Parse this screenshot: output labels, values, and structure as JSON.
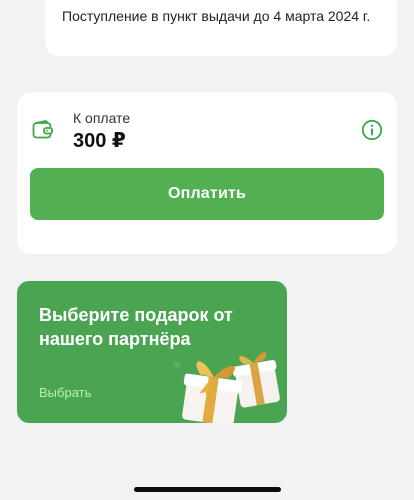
{
  "delivery": {
    "text": "Поступление в пункт выдачи до 4 марта 2024 г."
  },
  "payment": {
    "label": "К оплате",
    "amount": "300 ₽",
    "button_label": "Оплатить",
    "wallet_icon": "wallet-icon",
    "info_icon": "info-icon"
  },
  "promo": {
    "title": "Выберите подарок от нашего партнёра",
    "link_label": "Выбрать",
    "illustration": "gift-boxes-icon"
  },
  "colors": {
    "accent_green": "#52b053",
    "promo_green": "#4aa452",
    "promo_link": "#b9f2a8",
    "background": "#f2f2f4"
  }
}
